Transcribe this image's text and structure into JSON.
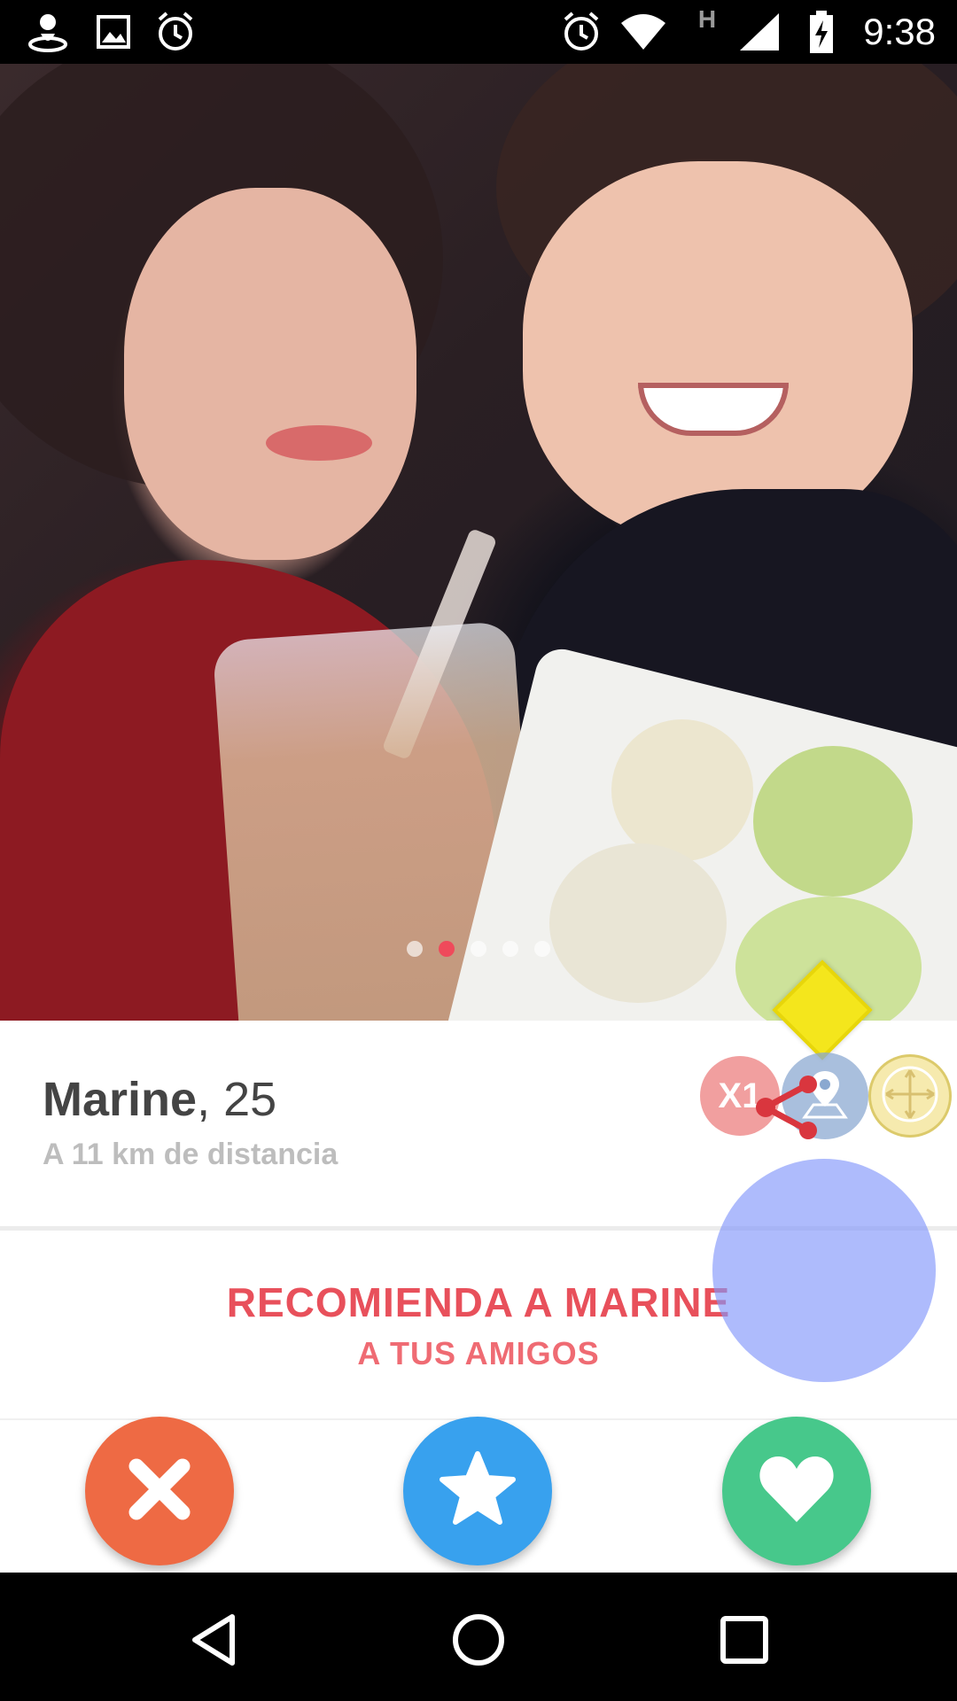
{
  "status_bar": {
    "time": "9:38",
    "left_icons": [
      "location-pin-icon",
      "image-icon",
      "alarm-icon"
    ],
    "right_icons": [
      "alarm-icon",
      "wifi-icon",
      "h-network-icon",
      "signal-icon",
      "battery-charging-icon"
    ],
    "network_label": "H"
  },
  "photo": {
    "pager_count": 5,
    "pager_active_index": 1
  },
  "profile": {
    "name": "Marine",
    "separator": ",",
    "age": "25",
    "distance": "A 11 km de distancia"
  },
  "recommend": {
    "line1": "RECOMIENDA A MARINE",
    "line2": "A TUS AMIGOS"
  },
  "actions": {
    "nope_icon": "close-icon",
    "super_like_icon": "star-icon",
    "like_icon": "heart-icon"
  },
  "overlay": {
    "x1_label": "X1"
  },
  "colors": {
    "nope": "#ee6a44",
    "super_like": "#38a1ee",
    "like": "#47c88b",
    "recommend_text": "#e8505b",
    "pager_active": "#ef4a5b"
  },
  "nav_bar": {
    "buttons": [
      "back-icon",
      "home-icon",
      "recents-icon"
    ]
  }
}
